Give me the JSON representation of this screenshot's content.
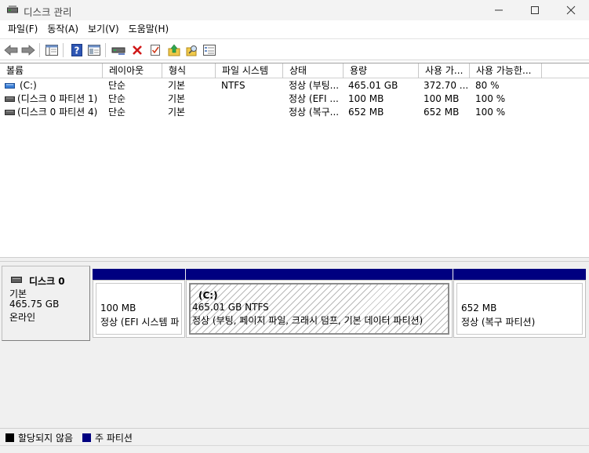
{
  "window": {
    "title": "디스크 관리"
  },
  "menu": [
    "파일(F)",
    "동작(A)",
    "보기(V)",
    "도움말(H)"
  ],
  "toolbar": {
    "buttons": [
      "back-icon",
      "forward-icon",
      "console-tree-icon",
      "help-icon",
      "properties-icon",
      "connect-disk-icon",
      "delete-icon",
      "check-icon",
      "up-arrow-icon",
      "search-icon",
      "details-icon"
    ]
  },
  "volume_list": {
    "columns": [
      "볼륨",
      "레이아웃",
      "형식",
      "파일 시스템",
      "상태",
      "용량",
      "사용 가...",
      "사용 가능한..."
    ],
    "rows": [
      {
        "volume": "(C:)",
        "layout": "단순",
        "type": "기본",
        "fs": "NTFS",
        "status": "정상 (부팅...",
        "capacity": "465.01 GB",
        "free": "372.70 ...",
        "pct": "80 %"
      },
      {
        "volume": "(디스크 0 파티션 1)",
        "layout": "단순",
        "type": "기본",
        "fs": "",
        "status": "정상 (EFI ...",
        "capacity": "100 MB",
        "free": "100 MB",
        "pct": "100 %"
      },
      {
        "volume": "(디스크 0 파티션 4)",
        "layout": "단순",
        "type": "기본",
        "fs": "",
        "status": "정상 (복구...",
        "capacity": "652 MB",
        "free": "652 MB",
        "pct": "100 %"
      }
    ]
  },
  "disk": {
    "name": "디스크 0",
    "type": "기본",
    "size": "465.75 GB",
    "status": "온라인",
    "partitions": [
      {
        "name": "",
        "size": "100 MB",
        "status": "정상 (EFI 시스템 파"
      },
      {
        "name": "(C:)",
        "size": "465.01 GB NTFS",
        "status": "정상 (부팅, 페이지 파일, 크래시 덤프, 기본 데이터 파티션)"
      },
      {
        "name": "",
        "size": "652 MB",
        "status": "정상 (복구 파티션)"
      }
    ]
  },
  "legend": {
    "unallocated": {
      "label": "할당되지 않음",
      "color": "#000000"
    },
    "primary": {
      "label": "주 파티션",
      "color": "#000080"
    }
  }
}
